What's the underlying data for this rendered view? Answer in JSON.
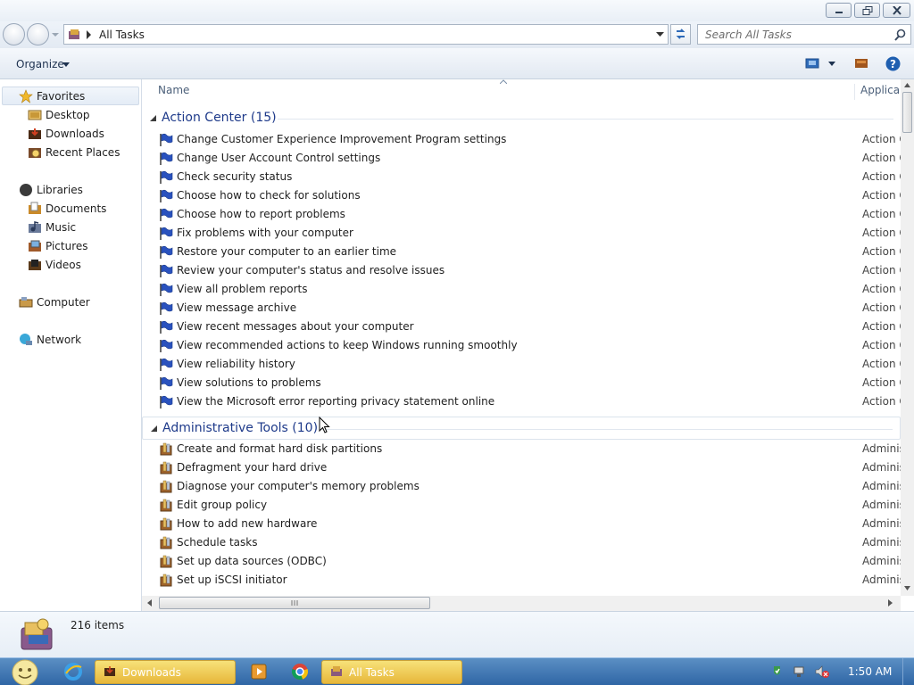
{
  "window": {
    "title_buttons": [
      "minimize",
      "maximize",
      "close"
    ]
  },
  "address": {
    "path": "All Tasks",
    "search_placeholder": "Search All Tasks"
  },
  "toolbar": {
    "organize": "Organize"
  },
  "nav": {
    "favorites": "Favorites",
    "desktop": "Desktop",
    "downloads": "Downloads",
    "recent": "Recent Places",
    "libraries": "Libraries",
    "documents": "Documents",
    "music": "Music",
    "pictures": "Pictures",
    "videos": "Videos",
    "computer": "Computer",
    "network": "Network"
  },
  "columns": {
    "name": "Name",
    "application": "Applica"
  },
  "groups": [
    {
      "title": "Action Center (15)",
      "app": "Action C",
      "items": [
        "Change Customer Experience Improvement Program settings",
        "Change User Account Control settings",
        "Check security status",
        "Choose how to check for solutions",
        "Choose how to report problems",
        "Fix problems with your computer",
        "Restore your computer to an earlier time",
        "Review your computer's status and resolve issues",
        "View all problem reports",
        "View message archive",
        "View recent messages about your computer",
        "View recommended actions to keep Windows running smoothly",
        "View reliability history",
        "View solutions to problems",
        "View the Microsoft error reporting privacy statement online"
      ]
    },
    {
      "title": "Administrative Tools (10)",
      "app": "Adminis",
      "items": [
        "Create and format hard disk partitions",
        "Defragment your hard drive",
        "Diagnose your computer's memory problems",
        "Edit group policy",
        "How to add new hardware",
        "Schedule tasks",
        "Set up data sources (ODBC)",
        "Set up iSCSI initiator"
      ]
    }
  ],
  "details": {
    "count": "216 items"
  },
  "taskbar": {
    "downloads": "Downloads",
    "alltasks": "All Tasks",
    "clock": "1:50 AM"
  }
}
